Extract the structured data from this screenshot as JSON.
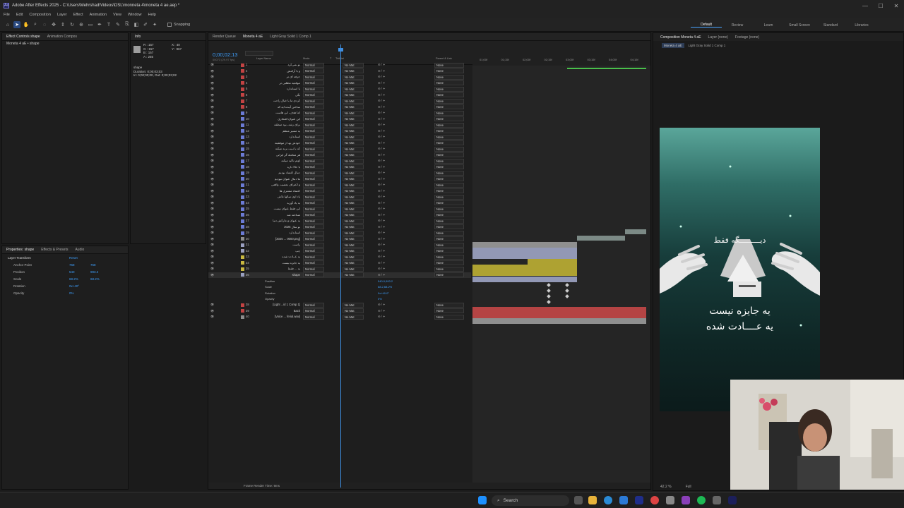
{
  "window": {
    "title": "Adobe After Effects 2025 - C:\\Users\\Mehrshad\\Videos\\DSL\\monneta 4\\moneta 4 ae.aep *",
    "controls": [
      "—",
      "☐",
      "✕"
    ]
  },
  "menu": [
    "File",
    "Edit",
    "Composition",
    "Layer",
    "Effect",
    "Animation",
    "View",
    "Window",
    "Help"
  ],
  "toolbar": {
    "snapping_label": "Snapping",
    "workspaces": [
      "Default",
      "Review",
      "Learn",
      "Small Screen",
      "Standard",
      "Libraries"
    ],
    "active_workspace": "Default"
  },
  "left_panel": {
    "tabs": [
      "Effect Controls shape",
      "Animation Compos"
    ],
    "item": "Moneta 4 aE • shape"
  },
  "info_panel": {
    "tab": "Info",
    "rgb": [
      "R : 157",
      "G : 157",
      "B : 157",
      "A : 255"
    ],
    "xy": [
      "X : 40",
      "Y : 967"
    ],
    "layer_name": "shape",
    "duration": "Duration: 0;00;03;03",
    "in_out": "In: 0;00;00;00, Out: 0;00;03;02"
  },
  "properties_panel": {
    "tabs": [
      "Properties: shape",
      "Effects & Presets",
      "Audio"
    ],
    "section": "Layer Transform",
    "reset_label": "Reset",
    "props": [
      {
        "name": "Anchor Point",
        "value": "768",
        "value2": "768"
      },
      {
        "name": "Position",
        "value": "540",
        "value2": "993.2"
      },
      {
        "name": "Scale",
        "value": "68.2%",
        "value2": "68.2%"
      },
      {
        "name": "Rotation",
        "value": "0x+40°",
        "value2": ""
      },
      {
        "name": "Opacity",
        "value": "0%",
        "value2": ""
      }
    ]
  },
  "timeline": {
    "tabs": [
      "Render Queue",
      "Moneta 4 aE",
      "Light Gray Solid 1 Comp 1"
    ],
    "timecode": "0;00;02;13",
    "timecode_sub": "00073 (29.97 fps)",
    "columns": [
      "Layer Name",
      "Mode",
      "T",
      "TrkMat",
      "Parent & Link"
    ],
    "ruler": [
      "01;00f",
      "01;15f",
      "02;00f",
      "02;15f",
      "03;00f",
      "03;15f",
      "04;00f",
      "04;15f"
    ],
    "mode_value": "Normal",
    "trkmat_value": "No Mat",
    "parent_value": "None",
    "layers": [
      {
        "num": "1",
        "name": "تو نمی‌کرد",
        "color": "#c24343"
      },
      {
        "num": "2",
        "name": "و با آرامش",
        "color": "#c24343"
      },
      {
        "num": "3",
        "name": "حرفه ای تر",
        "color": "#c24343"
      },
      {
        "num": "4",
        "name": "موقعیه مطلبی تر",
        "color": "#c24343"
      },
      {
        "num": "5",
        "name": "یا استاندارد",
        "color": "#c24343"
      },
      {
        "num": "6",
        "name": "بگی",
        "color": "#c24343"
      },
      {
        "num": "7",
        "name": "کردی ما با خیال راحت",
        "color": "#c24343"
      },
      {
        "num": "8",
        "name": "ساختن آینده ایه که",
        "color": "#c24343"
      },
      {
        "num": "9",
        "name": "اما هدف، این هاست",
        "color": "#6b7bd4"
      },
      {
        "num": "10",
        "name": "این عنوان افتخاری",
        "color": "#6b7bd4"
      },
      {
        "num": "11",
        "name": "برای رشد، بود منطقه",
        "color": "#6b7bd4"
      },
      {
        "num": "12",
        "name": "یه مسیر منظم",
        "color": "#6b7bd4"
      },
      {
        "num": "13",
        "name": "استاندارد",
        "color": "#6b7bd4"
      },
      {
        "num": "14",
        "name": "خودش بهـ از موفقیته",
        "color": "#6b7bd4"
      },
      {
        "num": "15",
        "name": "که با ثـبت برند میکنه",
        "color": "#6b7bd4"
      },
      {
        "num": "16",
        "name": "هر معامله گر ایرانی",
        "color": "#6b7bd4"
      },
      {
        "num": "17",
        "name": "اونم تاکید میکنه",
        "color": "#6b7bd4"
      },
      {
        "num": "18",
        "name": "با حالا داره",
        "color": "#6b7bd4"
      },
      {
        "num": "19",
        "name": "دنبال اعتماد بودیم",
        "color": "#6b7bd4"
      },
      {
        "num": "20",
        "name": "ما دنبال عنوان نبودیم",
        "color": "#6b7bd4"
      },
      {
        "num": "21",
        "name": "و اعتراف بعضیت واقعی",
        "color": "#6b7bd4"
      },
      {
        "num": "22",
        "name": "اعتماد مشتری ها",
        "color": "#6b7bd4"
      },
      {
        "num": "23",
        "name": "یاد اون سالها نلاش",
        "color": "#6b7bd4"
      },
      {
        "num": "24",
        "name": "یه یاد آوریه",
        "color": "#6b7bd4"
      },
      {
        "num": "25",
        "name": "این فقط عنوان نیست",
        "color": "#6b7bd4"
      },
      {
        "num": "26",
        "name": "شناخته شد",
        "color": "#6b7bd4"
      },
      {
        "num": "27",
        "name": "یه عنوان و مارکش دنیا",
        "color": "#6b7bd4"
      },
      {
        "num": "28",
        "name": "تو سال 2025",
        "color": "#6b7bd4"
      },
      {
        "num": "29",
        "name": "استاندارد",
        "color": "#6b7bd4"
      },
      {
        "num": "30",
        "name": "[2025 ... 0000.png]",
        "color": "#8d8d8d"
      },
      {
        "num": "31",
        "name": "راست",
        "color": "#9aa0c0"
      },
      {
        "num": "32",
        "name": "چپ",
        "color": "#9aa0c0"
      },
      {
        "num": "33",
        "name": "یه عــادت شده",
        "color": "#c9b840"
      },
      {
        "num": "34",
        "name": "یه جایزه نیست",
        "color": "#c9b840"
      },
      {
        "num": "35",
        "name": "یه ... فقط",
        "color": "#c9b840"
      },
      {
        "num": "36",
        "name": "shape",
        "color": "#9aa0c0"
      }
    ],
    "subprops": [
      {
        "name": "Position",
        "value": "540.0,993.2"
      },
      {
        "name": "Scale",
        "value": "68.2,68.2%"
      },
      {
        "name": "Rotation",
        "value": "0x+40.0°"
      },
      {
        "name": "Opacity",
        "value": "0%"
      }
    ],
    "bottom_layers": [
      {
        "num": "38",
        "name": "[Light ...id 1 Comp 1]",
        "color": "#c24343"
      },
      {
        "num": "39",
        "name": "Back",
        "color": "#c24343"
      },
      {
        "num": "40",
        "name": "[Voice ... ferial.wav]",
        "color": "#8d8d8d"
      }
    ],
    "footer": "Frame Render Time: 9ms"
  },
  "viewer": {
    "tabs": [
      "Composition Moneta 4 aE",
      "Layer (none)",
      "Footage (none)"
    ],
    "subtabs": [
      "Moneta 4 aE",
      "Light Gray Solid 1 Comp 1"
    ],
    "comp_text": {
      "line1": "دیـــــــــگه فقط",
      "line2": "یه جایزه نیست",
      "line3": "یه عــــادت شده"
    },
    "zoom": "42.2 %",
    "resolution": "Full"
  },
  "taskbar": {
    "search_label": "Search"
  }
}
